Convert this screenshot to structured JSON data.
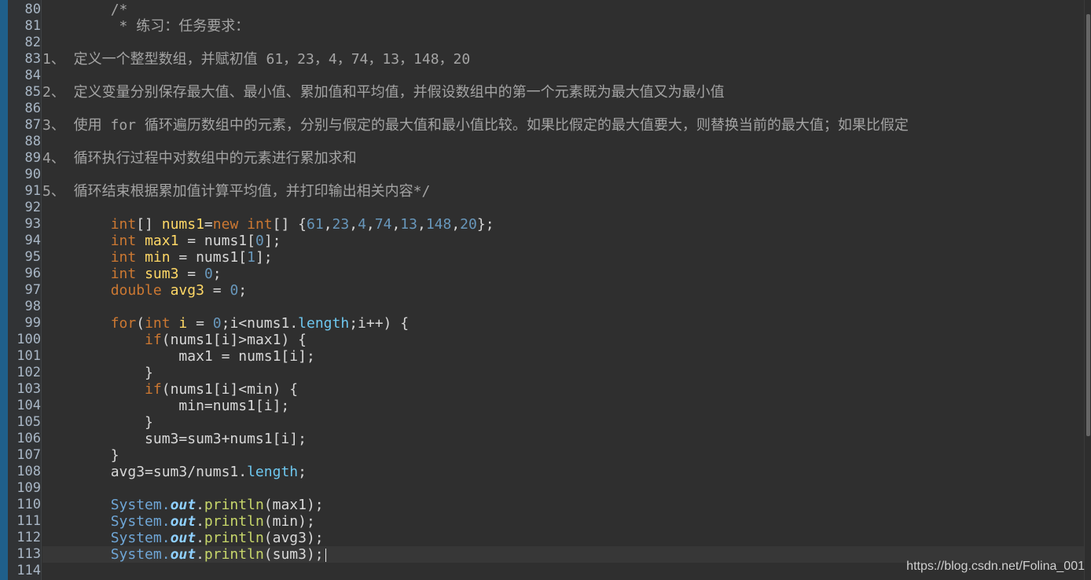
{
  "lines": [
    {
      "n": "80",
      "text": "        /*"
    },
    {
      "n": "81",
      "text": "         * 练习：任务要求："
    },
    {
      "n": "82",
      "text": ""
    },
    {
      "n": "83",
      "text": "1、 定义一个整型数组，并赋初值 61，23，4，74，13，148，20"
    },
    {
      "n": "84",
      "text": ""
    },
    {
      "n": "85",
      "text": "2、 定义变量分别保存最大值、最小值、累加值和平均值，并假设数组中的第一个元素既为最大值又为最小值"
    },
    {
      "n": "86",
      "text": ""
    },
    {
      "n": "87",
      "text": "3、 使用 for 循环遍历数组中的元素，分别与假定的最大值和最小值比较。如果比假定的最大值要大，则替换当前的最大值；如果比假定"
    },
    {
      "n": "88",
      "text": ""
    },
    {
      "n": "89",
      "text": "4、 循环执行过程中对数组中的元素进行累加求和"
    },
    {
      "n": "90",
      "text": ""
    },
    {
      "n": "91",
      "text": "5、 循环结束根据累加值计算平均值，并打印输出相关内容*/"
    },
    {
      "n": "92",
      "text": ""
    },
    {
      "n": "93",
      "tokens": [
        {
          "t": "        "
        },
        {
          "c": "kw",
          "t": "int"
        },
        {
          "t": "[] "
        },
        {
          "c": "var",
          "t": "nums1"
        },
        {
          "t": "="
        },
        {
          "c": "kw",
          "t": "new"
        },
        {
          "t": " "
        },
        {
          "c": "kw",
          "t": "int"
        },
        {
          "t": "[] {"
        },
        {
          "c": "num",
          "t": "61"
        },
        {
          "t": ","
        },
        {
          "c": "num",
          "t": "23"
        },
        {
          "t": ","
        },
        {
          "c": "num",
          "t": "4"
        },
        {
          "t": ","
        },
        {
          "c": "num",
          "t": "74"
        },
        {
          "t": ","
        },
        {
          "c": "num",
          "t": "13"
        },
        {
          "t": ","
        },
        {
          "c": "num",
          "t": "148"
        },
        {
          "t": ","
        },
        {
          "c": "num",
          "t": "20"
        },
        {
          "t": "};"
        }
      ]
    },
    {
      "n": "94",
      "tokens": [
        {
          "t": "        "
        },
        {
          "c": "kw",
          "t": "int"
        },
        {
          "t": " "
        },
        {
          "c": "var",
          "t": "max1"
        },
        {
          "t": " = nums1["
        },
        {
          "c": "num",
          "t": "0"
        },
        {
          "t": "];"
        }
      ]
    },
    {
      "n": "95",
      "tokens": [
        {
          "t": "        "
        },
        {
          "c": "kw",
          "t": "int"
        },
        {
          "t": " "
        },
        {
          "c": "var",
          "t": "min"
        },
        {
          "t": " = nums1["
        },
        {
          "c": "num",
          "t": "1"
        },
        {
          "t": "];"
        }
      ]
    },
    {
      "n": "96",
      "tokens": [
        {
          "t": "        "
        },
        {
          "c": "kw",
          "t": "int"
        },
        {
          "t": " "
        },
        {
          "c": "var",
          "t": "sum3"
        },
        {
          "t": " = "
        },
        {
          "c": "num",
          "t": "0"
        },
        {
          "t": ";"
        }
      ]
    },
    {
      "n": "97",
      "tokens": [
        {
          "t": "        "
        },
        {
          "c": "kw",
          "t": "double"
        },
        {
          "t": " "
        },
        {
          "c": "var",
          "t": "avg3"
        },
        {
          "t": " = "
        },
        {
          "c": "num",
          "t": "0"
        },
        {
          "t": ";"
        }
      ]
    },
    {
      "n": "98",
      "text": ""
    },
    {
      "n": "99",
      "tokens": [
        {
          "t": "        "
        },
        {
          "c": "kw",
          "t": "for"
        },
        {
          "t": "("
        },
        {
          "c": "kw",
          "t": "int"
        },
        {
          "t": " "
        },
        {
          "c": "var",
          "t": "i"
        },
        {
          "t": " = "
        },
        {
          "c": "num",
          "t": "0"
        },
        {
          "t": ";i<nums1."
        },
        {
          "c": "fld",
          "t": "length"
        },
        {
          "t": ";i++) {"
        }
      ]
    },
    {
      "n": "100",
      "tokens": [
        {
          "t": "            "
        },
        {
          "c": "kw",
          "t": "if"
        },
        {
          "t": "(nums1[i]>max1) {"
        }
      ]
    },
    {
      "n": "101",
      "tokens": [
        {
          "t": "                max1 = nums1[i];"
        }
      ]
    },
    {
      "n": "102",
      "tokens": [
        {
          "t": "            }"
        }
      ]
    },
    {
      "n": "103",
      "tokens": [
        {
          "t": "            "
        },
        {
          "c": "kw",
          "t": "if"
        },
        {
          "t": "(nums1[i]<min) {"
        }
      ]
    },
    {
      "n": "104",
      "tokens": [
        {
          "t": "                min=nums1[i];"
        }
      ]
    },
    {
      "n": "105",
      "tokens": [
        {
          "t": "            }"
        }
      ]
    },
    {
      "n": "106",
      "tokens": [
        {
          "t": "            sum3=sum3+nums1[i];"
        }
      ]
    },
    {
      "n": "107",
      "tokens": [
        {
          "t": "        }"
        }
      ]
    },
    {
      "n": "108",
      "tokens": [
        {
          "t": "        avg3=sum3/nums1."
        },
        {
          "c": "fld",
          "t": "length"
        },
        {
          "t": ";"
        }
      ]
    },
    {
      "n": "109",
      "text": ""
    },
    {
      "n": "110",
      "tokens": [
        {
          "t": "        "
        },
        {
          "c": "cls",
          "t": "System."
        },
        {
          "c": "out",
          "t": "out"
        },
        {
          "t": "."
        },
        {
          "c": "method",
          "t": "println"
        },
        {
          "t": "(max1);"
        }
      ]
    },
    {
      "n": "111",
      "tokens": [
        {
          "t": "        "
        },
        {
          "c": "cls",
          "t": "System."
        },
        {
          "c": "out",
          "t": "out"
        },
        {
          "t": "."
        },
        {
          "c": "method",
          "t": "println"
        },
        {
          "t": "(min);"
        }
      ]
    },
    {
      "n": "112",
      "tokens": [
        {
          "t": "        "
        },
        {
          "c": "cls",
          "t": "System."
        },
        {
          "c": "out",
          "t": "out"
        },
        {
          "t": "."
        },
        {
          "c": "method",
          "t": "println"
        },
        {
          "t": "(avg3);"
        }
      ]
    },
    {
      "n": "113",
      "current": true,
      "tokens": [
        {
          "t": "        "
        },
        {
          "c": "cls",
          "t": "System."
        },
        {
          "c": "out",
          "t": "out"
        },
        {
          "t": "."
        },
        {
          "c": "method",
          "t": "println"
        },
        {
          "t": "(sum3);"
        }
      ]
    },
    {
      "n": "114",
      "text": ""
    }
  ],
  "watermark": "https://blog.csdn.net/Folina_001",
  "colors": {
    "background": "#2f2f2f",
    "keyword": "#cc7832",
    "number": "#6897bb",
    "variable": "#ffd866",
    "comment": "#a4a4a4",
    "method": "#c7d66a"
  }
}
